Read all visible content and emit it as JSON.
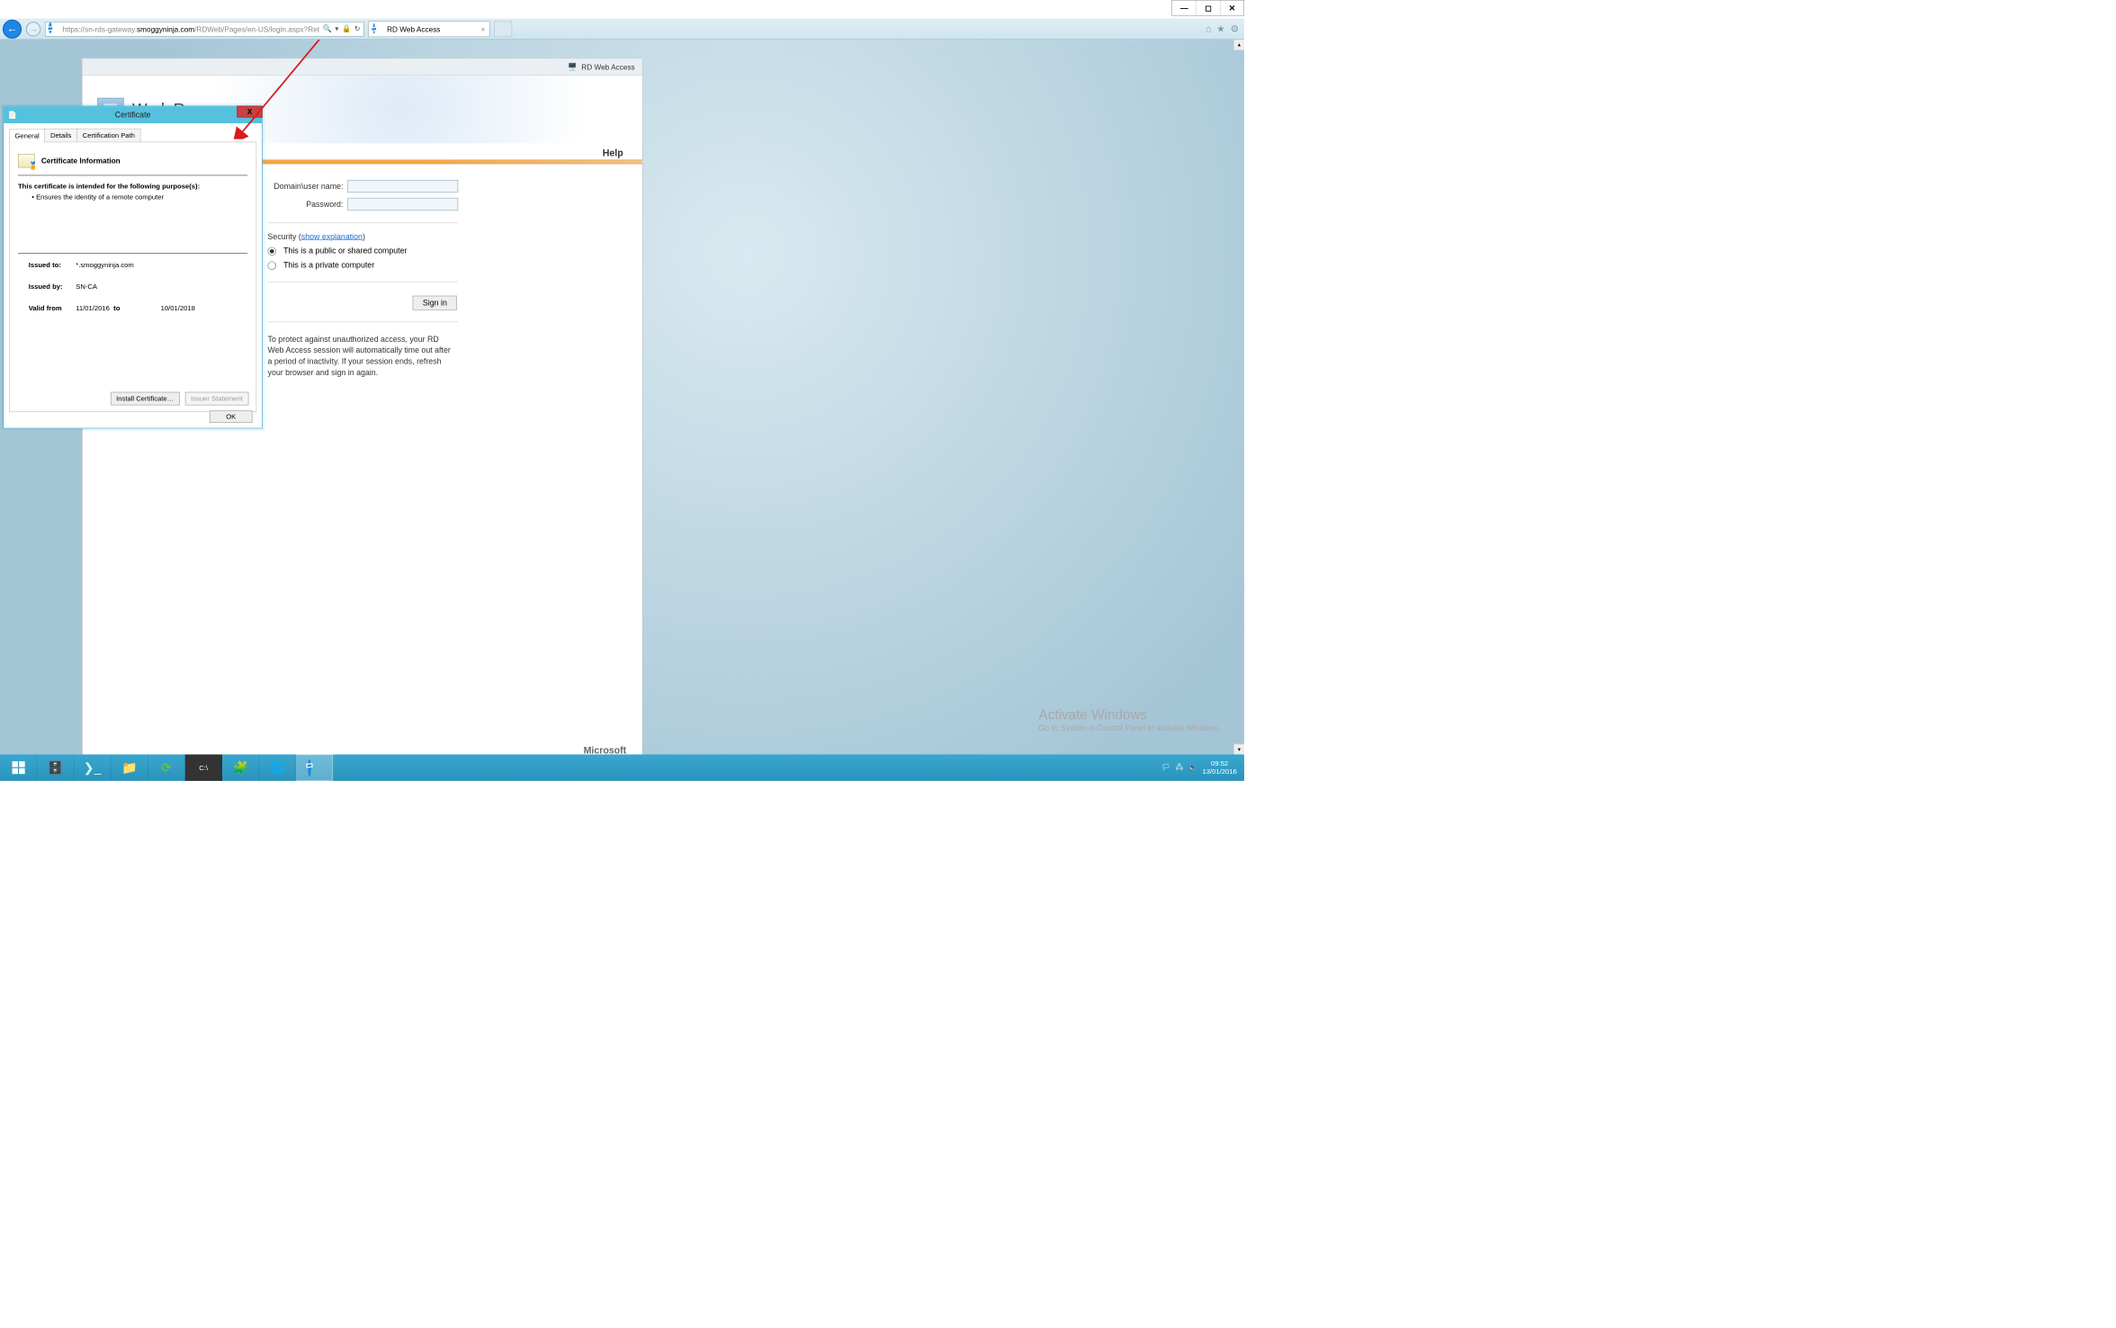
{
  "window": {
    "min": "—",
    "max": "◻",
    "close": "✕"
  },
  "browser": {
    "back": "←",
    "fwd": "→",
    "url_pre": "https://sn-rds-gateway.",
    "url_domain": "smoggyninja.com",
    "url_post": "/RDWeb/Pages/en-US/login.aspx?Ret",
    "search_glyph": "🔍",
    "dropdown": "▾",
    "lock": "🔒",
    "refresh": "↻",
    "tab_title": "RD Web Access",
    "tab_close": "×",
    "home": "⌂",
    "star": "★",
    "gear": "⚙"
  },
  "rdweb": {
    "topbar": "RD Web Access",
    "title": "Work Resources",
    "help": "Help",
    "domain_label": "Domain\\user name:",
    "password_label": "Password:",
    "security_pre": "Security (",
    "security_link": "show explanation",
    "security_post": ")",
    "radio_public": "This is a public or shared computer",
    "radio_private": "This is a private computer",
    "signin": "Sign in",
    "note": "To protect against unauthorized access, your RD Web Access session will automatically time out after a period of inactivity. If your session ends, refresh your browser and sign in again.",
    "brand": "Microsoft"
  },
  "watermark": {
    "t1": "Activate Windows",
    "t2": "Go to System in Control Panel to activate Windows."
  },
  "cert": {
    "title": "Certificate",
    "close": "X",
    "tabs": {
      "general": "General",
      "details": "Details",
      "path": "Certification Path"
    },
    "hdr": "Certificate Information",
    "purpose": "This certificate is intended for the following purpose(s):",
    "bullet": "• Ensures the identity of a remote computer",
    "issued_to_k": "Issued to:",
    "issued_to_v": "*.smoggyninja.com",
    "issued_by_k": "Issued by:",
    "issued_by_v": "SN-CA",
    "valid_k": "Valid from",
    "valid_from": "11/01/2016",
    "valid_mid": "to",
    "valid_to": "10/01/2018",
    "install": "Install Certificate…",
    "issuer": "Issuer Statement",
    "ok": "OK"
  },
  "tray": {
    "flag": "🏳",
    "net": "🖧",
    "vol": "🔈",
    "time": "09:52",
    "date": "13/01/2016"
  }
}
